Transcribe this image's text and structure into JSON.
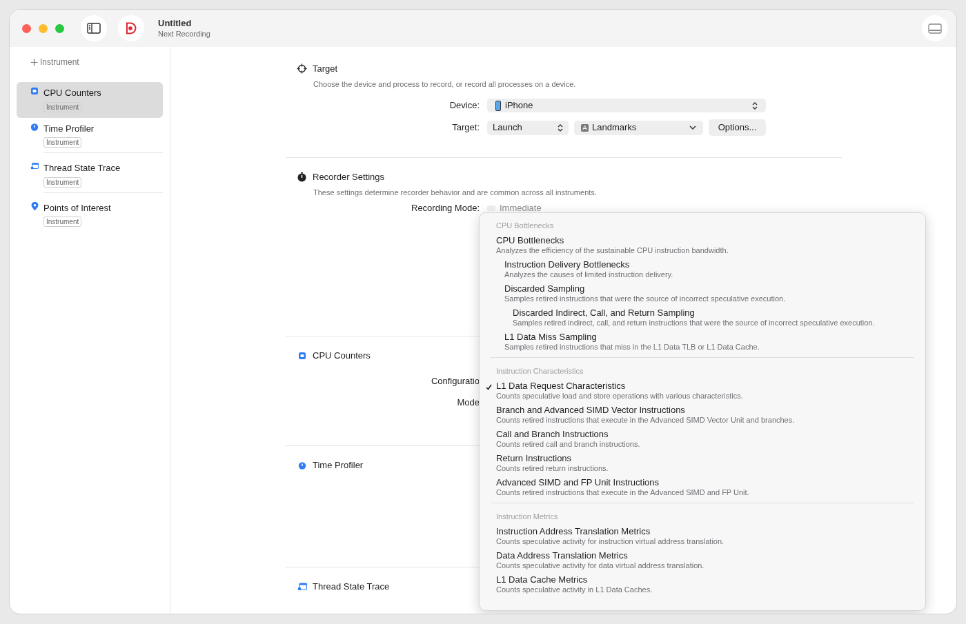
{
  "window": {
    "title": "Untitled",
    "subtitle": "Next Recording"
  },
  "sidebar": {
    "add_button": "Instrument",
    "items": [
      {
        "name": "CPU Counters",
        "tag": "Instrument",
        "kind": "counters",
        "selected": true
      },
      {
        "name": "Time Profiler",
        "tag": "Instrument",
        "kind": "profiler",
        "selected": false
      },
      {
        "name": "Thread State Trace",
        "tag": "Instrument",
        "kind": "trace",
        "selected": false
      },
      {
        "name": "Points of Interest",
        "tag": "Instrument",
        "kind": "poi",
        "selected": false
      }
    ]
  },
  "target": {
    "title": "Target",
    "description": "Choose the device and process to record, or record all processes on a device.",
    "device_label": "Device:",
    "device": "iPhone",
    "target_label": "Target:",
    "launch": "Launch",
    "app": "Landmarks",
    "options_button": "Options..."
  },
  "recorder": {
    "title": "Recorder Settings",
    "description": "These settings determine recorder behavior and are common across all instruments.",
    "mode_label": "Recording Mode:",
    "mode": "Immediate"
  },
  "cpu_counters": {
    "title": "CPU Counters",
    "configuration_label": "Configuratio",
    "mode_label": "Mode"
  },
  "time_profiler": {
    "title": "Time Profiler"
  },
  "thread_state_trace": {
    "title": "Thread State Trace"
  },
  "menu": {
    "groups": [
      {
        "header": "CPU Bottlenecks",
        "items": [
          {
            "title": "CPU Bottlenecks",
            "description": "Analyzes the efficiency of the sustainable CPU instruction bandwidth.",
            "checked": false,
            "children": [
              {
                "title": "Instruction Delivery Bottlenecks",
                "description": "Analyzes the causes of limited instruction delivery.",
                "checked": false
              },
              {
                "title": "Discarded Sampling",
                "description": "Samples retired instructions that were the source of incorrect speculative execution.",
                "checked": false,
                "children": [
                  {
                    "title": "Discarded Indirect, Call, and Return Sampling",
                    "description": "Samples retired indirect, call, and return instructions that were the source of incorrect speculative execution.",
                    "checked": false
                  }
                ]
              },
              {
                "title": "L1 Data Miss Sampling",
                "description": "Samples retired instructions that miss in the L1 Data TLB or L1 Data Cache.",
                "checked": false
              }
            ]
          }
        ]
      },
      {
        "header": "Instruction Characteristics",
        "items": [
          {
            "title": "L1 Data Request Characteristics",
            "description": "Counts speculative load and store operations with various characteristics.",
            "checked": true
          },
          {
            "title": "Branch and Advanced SIMD Vector Instructions",
            "description": "Counts retired instructions that execute in the Advanced SIMD Vector Unit and branches.",
            "checked": false
          },
          {
            "title": "Call and Branch Instructions",
            "description": "Counts retired call and branch instructions.",
            "checked": false
          },
          {
            "title": "Return Instructions",
            "description": "Counts retired return instructions.",
            "checked": false
          },
          {
            "title": "Advanced SIMD and FP Unit Instructions",
            "description": "Counts retired instructions that execute in the Advanced SIMD and FP Unit.",
            "checked": false
          }
        ]
      },
      {
        "header": "Instruction Metrics",
        "items": [
          {
            "title": "Instruction Address Translation Metrics",
            "description": "Counts speculative activity for instruction virtual address translation.",
            "checked": false
          },
          {
            "title": "Data Address Translation Metrics",
            "description": "Counts speculative activity for data virtual address translation.",
            "checked": false
          },
          {
            "title": "L1 Data Cache Metrics",
            "description": "Counts speculative activity in L1 Data Caches.",
            "checked": false
          }
        ]
      }
    ]
  }
}
